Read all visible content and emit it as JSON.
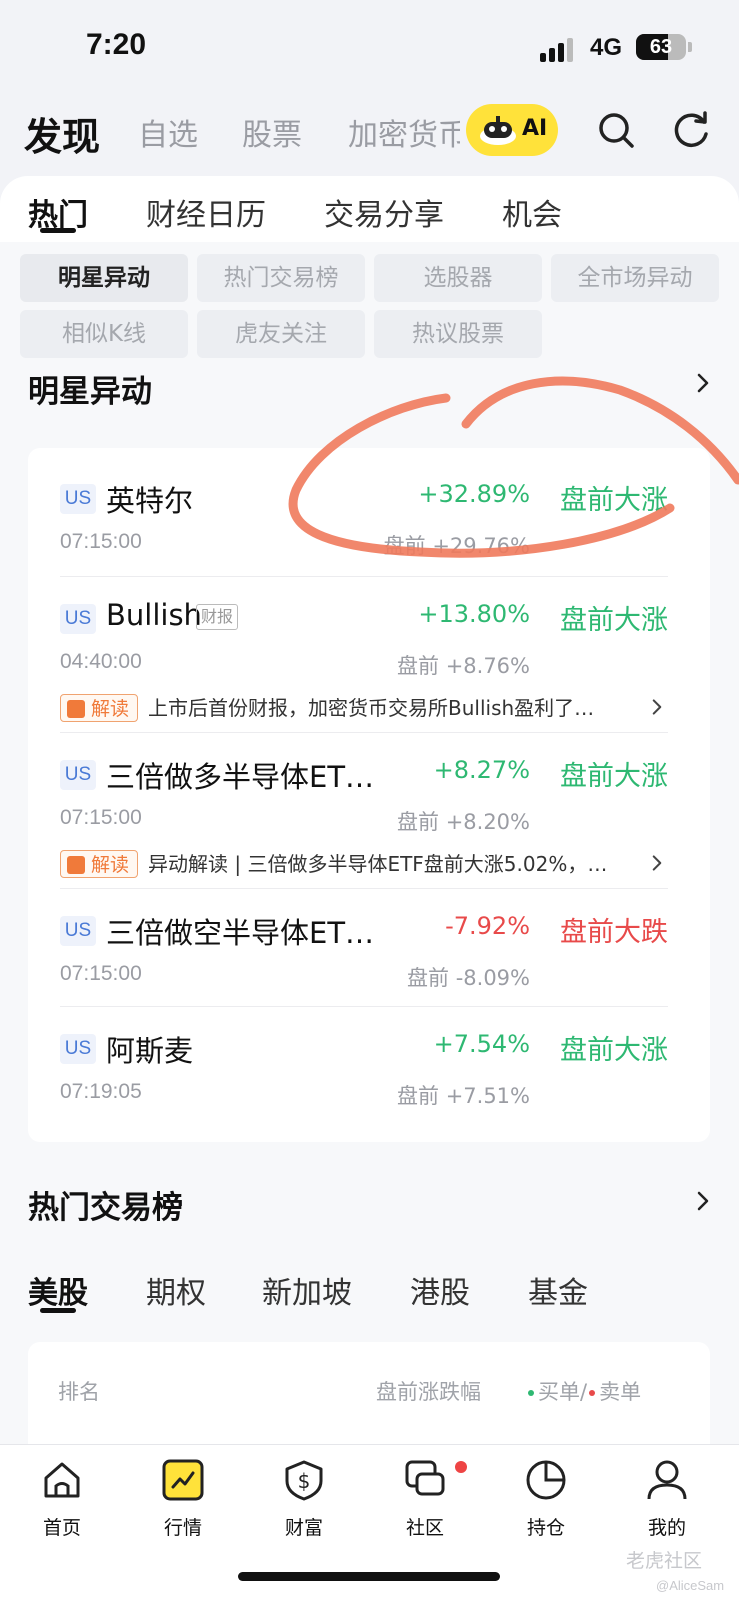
{
  "status_bar": {
    "time": "7:20",
    "network": "4G",
    "battery": "63",
    "battery_level": 0.63
  },
  "top_nav": {
    "title": "发现",
    "tabs": [
      "自选",
      "股票",
      "加密货币"
    ],
    "ai_label": "AI"
  },
  "sub_tabs": [
    "热门",
    "财经日历",
    "交易分享",
    "机会"
  ],
  "chips": [
    "明星异动",
    "热门交易榜",
    "选股器",
    "全市场异动",
    "相似K线",
    "虎友关注",
    "热议股票"
  ],
  "star_section": {
    "title": "明星异动",
    "rows": [
      {
        "market": "US",
        "name": "英特尔",
        "tag": "",
        "change": "+32.89%",
        "status": "盘前大涨",
        "time": "07:15:00",
        "premarket": "盘前 +29.76%",
        "news_badge": "",
        "news": "",
        "color": "#2eb872"
      },
      {
        "market": "US",
        "name": "Bullish",
        "tag": "财报",
        "change": "+13.80%",
        "status": "盘前大涨",
        "time": "04:40:00",
        "premarket": "盘前 +8.76%",
        "news_badge": "解读",
        "news": "上市后首份财报，加密货币交易所Bullish盈利了…",
        "color": "#2eb872"
      },
      {
        "market": "US",
        "name": "三倍做多半导体ET…",
        "tag": "",
        "change": "+8.27%",
        "status": "盘前大涨",
        "time": "07:15:00",
        "premarket": "盘前 +8.20%",
        "news_badge": "解读",
        "news": "异动解读 | 三倍做多半导体ETF盘前大涨5.02%，…",
        "color": "#2eb872"
      },
      {
        "market": "US",
        "name": "三倍做空半导体ET…",
        "tag": "",
        "change": "-7.92%",
        "status": "盘前大跌",
        "time": "07:15:00",
        "premarket": "盘前 -8.09%",
        "news_badge": "",
        "news": "",
        "color": "#e84a4a"
      },
      {
        "market": "US",
        "name": "阿斯麦",
        "tag": "",
        "change": "+7.54%",
        "status": "盘前大涨",
        "time": "07:19:05",
        "premarket": "盘前 +7.51%",
        "news_badge": "",
        "news": "",
        "color": "#2eb872"
      }
    ]
  },
  "hot_section": {
    "title": "热门交易榜",
    "tabs": [
      "美股",
      "期权",
      "新加坡",
      "港股",
      "基金"
    ],
    "headers": {
      "rank": "排名",
      "change": "盘前涨跌幅",
      "buy": "买单/",
      "sell": "卖单"
    }
  },
  "bottom_nav": [
    "首页",
    "行情",
    "财富",
    "社区",
    "持仓",
    "我的"
  ],
  "watermark": {
    "brand": "老虎社区",
    "user": "@AliceSam"
  },
  "colors": {
    "up": "#2eb872",
    "down": "#e84a4a",
    "accent": "#ffe23a",
    "annotation": "#f07a5c"
  }
}
